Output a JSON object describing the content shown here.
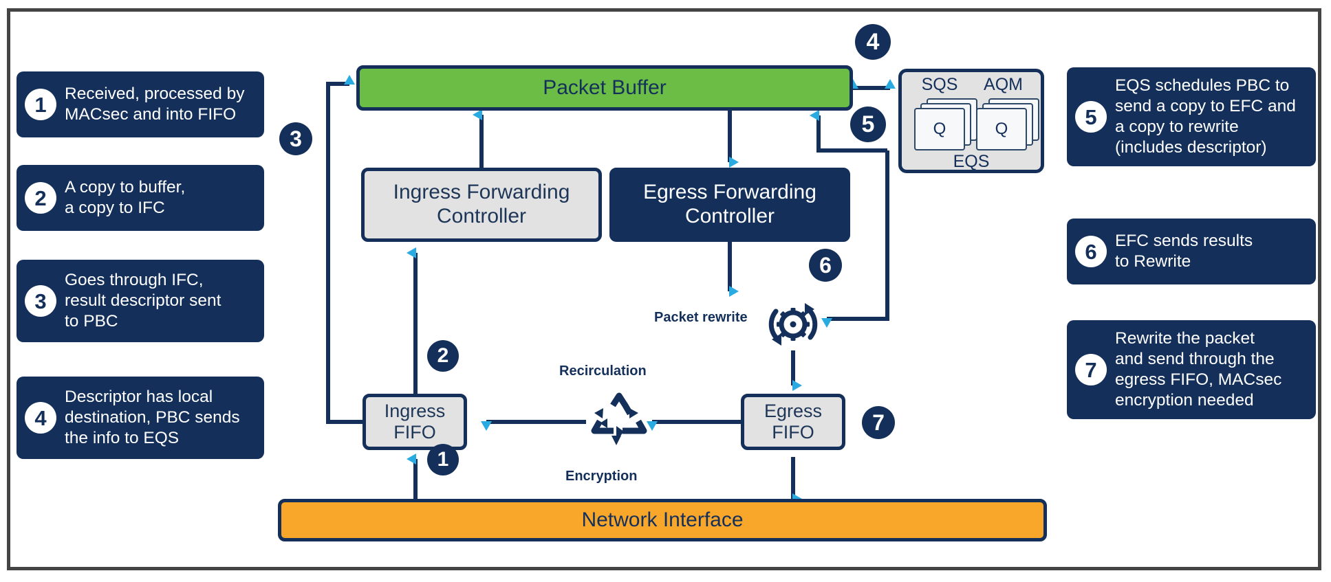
{
  "colors": {
    "navy": "#14305a",
    "green": "#6cbd45",
    "orange": "#f9a72b",
    "grey": "#e2e2e2",
    "arrow_head": "#29abe2",
    "frame": "#444444"
  },
  "left_callouts": [
    {
      "number": "1",
      "text": "Received, processed by\nMACsec and into FIFO"
    },
    {
      "number": "2",
      "text": "A copy to buffer,\na copy to IFC"
    },
    {
      "number": "3",
      "text": "Goes through IFC,\nresult descriptor sent\nto PBC"
    },
    {
      "number": "4",
      "text": "Descriptor has local\ndestination, PBC sends\nthe info to EQS"
    }
  ],
  "right_callouts": [
    {
      "number": "5",
      "text": "EQS schedules PBC to\nsend a copy to EFC and\na copy to rewrite\n(includes descriptor)"
    },
    {
      "number": "6",
      "text": "EFC sends results\nto Rewrite"
    },
    {
      "number": "7",
      "text": "Rewrite the packet\nand send through the\negress FIFO, MACsec\nencryption needed"
    }
  ],
  "blocks": {
    "packet_buffer": "Packet Buffer",
    "ingress_forwarding_controller": "Ingress Forwarding\nController",
    "egress_forwarding_controller": "Egress Forwarding\nController",
    "ingress_fifo": "Ingress\nFIFO",
    "egress_fifo": "Egress\nFIFO",
    "network_interface": "Network Interface"
  },
  "eqs": {
    "title": "EQS",
    "sqs_label": "SQS",
    "aqm_label": "AQM",
    "queue_label": "Q"
  },
  "labels": {
    "packet_rewrite": "Packet rewrite",
    "recirculation": "Recirculation",
    "encryption": "Encryption"
  },
  "step_badges": [
    {
      "number": "1"
    },
    {
      "number": "2"
    },
    {
      "number": "3"
    },
    {
      "number": "4"
    },
    {
      "number": "5"
    },
    {
      "number": "6"
    },
    {
      "number": "7"
    }
  ],
  "icons": {
    "recycle": "recycle-icon",
    "gear_rewrite": "gear-rewrite-icon"
  }
}
